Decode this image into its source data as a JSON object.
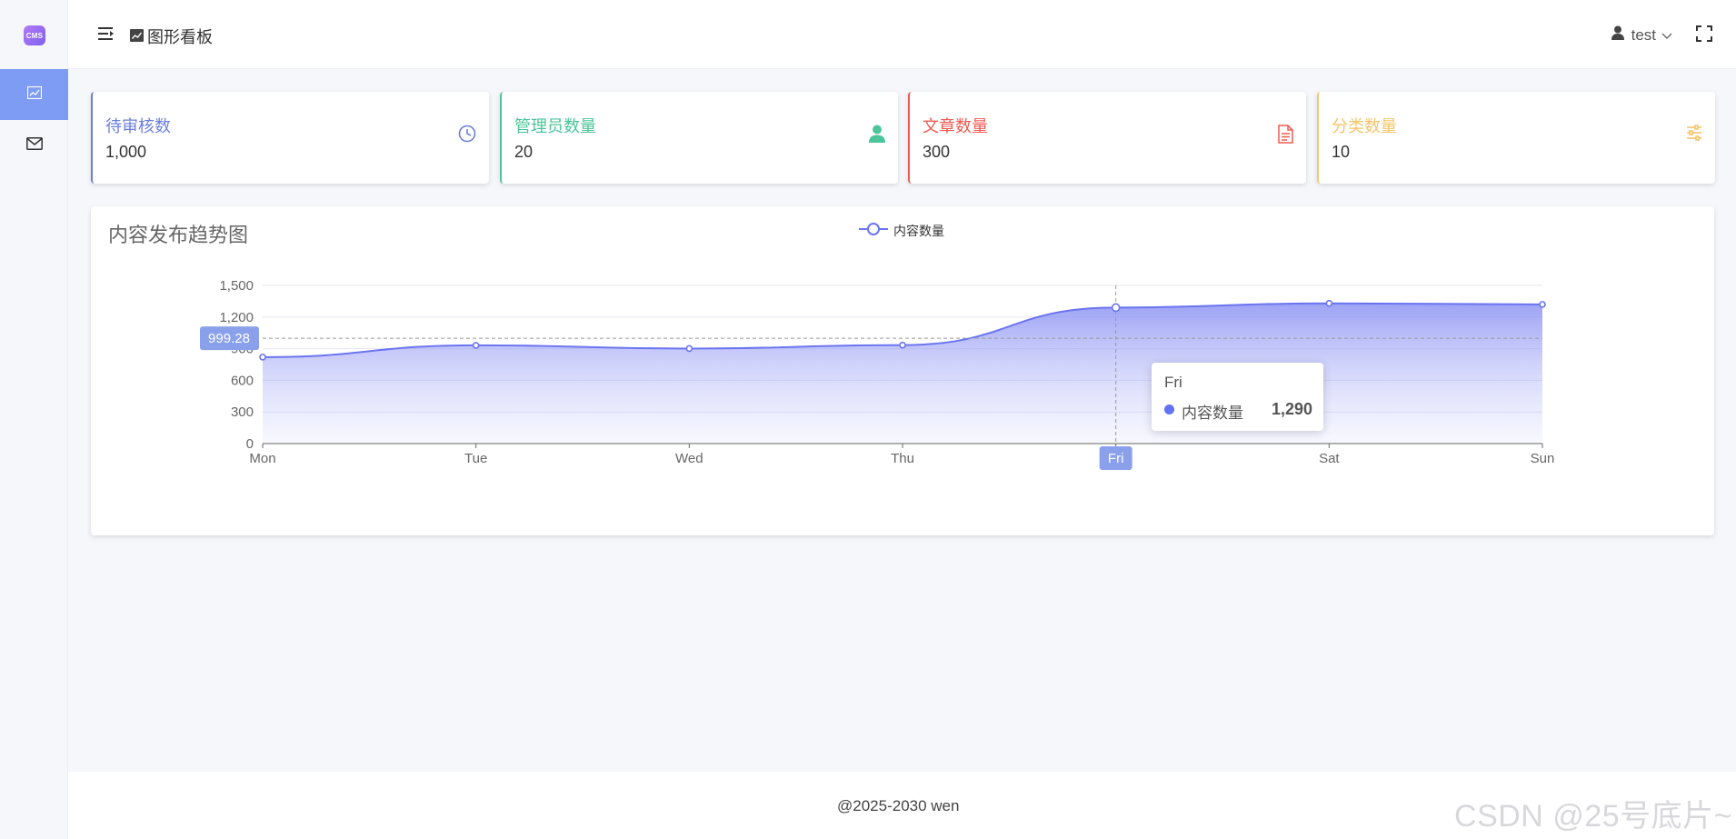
{
  "app": {
    "logo_text": "CMS"
  },
  "sidebar": {
    "items": [
      {
        "icon": "chart-icon",
        "active": true
      },
      {
        "icon": "mail-icon",
        "active": false
      }
    ]
  },
  "header": {
    "breadcrumb": "图形看板",
    "user": "test"
  },
  "stats": [
    {
      "label": "待审核数",
      "value": "1,000",
      "color": "#6c7fd8",
      "icon": "clock-icon"
    },
    {
      "label": "管理员数量",
      "value": "20",
      "color": "#4cc59a",
      "icon": "user-icon"
    },
    {
      "label": "文章数量",
      "value": "300",
      "color": "#ee5a52",
      "icon": "document-icon"
    },
    {
      "label": "分类数量",
      "value": "10",
      "color": "#f5c56b",
      "icon": "sliders-icon"
    }
  ],
  "chart": {
    "title": "内容发布趋势图",
    "crosshair_value": "999.28",
    "highlight_label": "Fri",
    "tooltip": {
      "title": "Fri",
      "series": "内容数量",
      "value": "1,290"
    }
  },
  "chart_data": {
    "type": "area",
    "categories": [
      "Mon",
      "Tue",
      "Wed",
      "Thu",
      "Fri",
      "Sat",
      "Sun"
    ],
    "series": [
      {
        "name": "内容数量",
        "values": [
          820,
          932,
          901,
          934,
          1290,
          1330,
          1320
        ]
      }
    ],
    "y_ticks": [
      "0",
      "300",
      "600",
      "900",
      "1,200",
      "1,500"
    ],
    "ylim": [
      0,
      1500
    ],
    "smooth": true,
    "color": "#6b74f0",
    "grid": true,
    "legend": "top-center"
  },
  "footer": {
    "text": "@2025-2030 wen"
  },
  "watermark": "CSDN @25号底片~"
}
